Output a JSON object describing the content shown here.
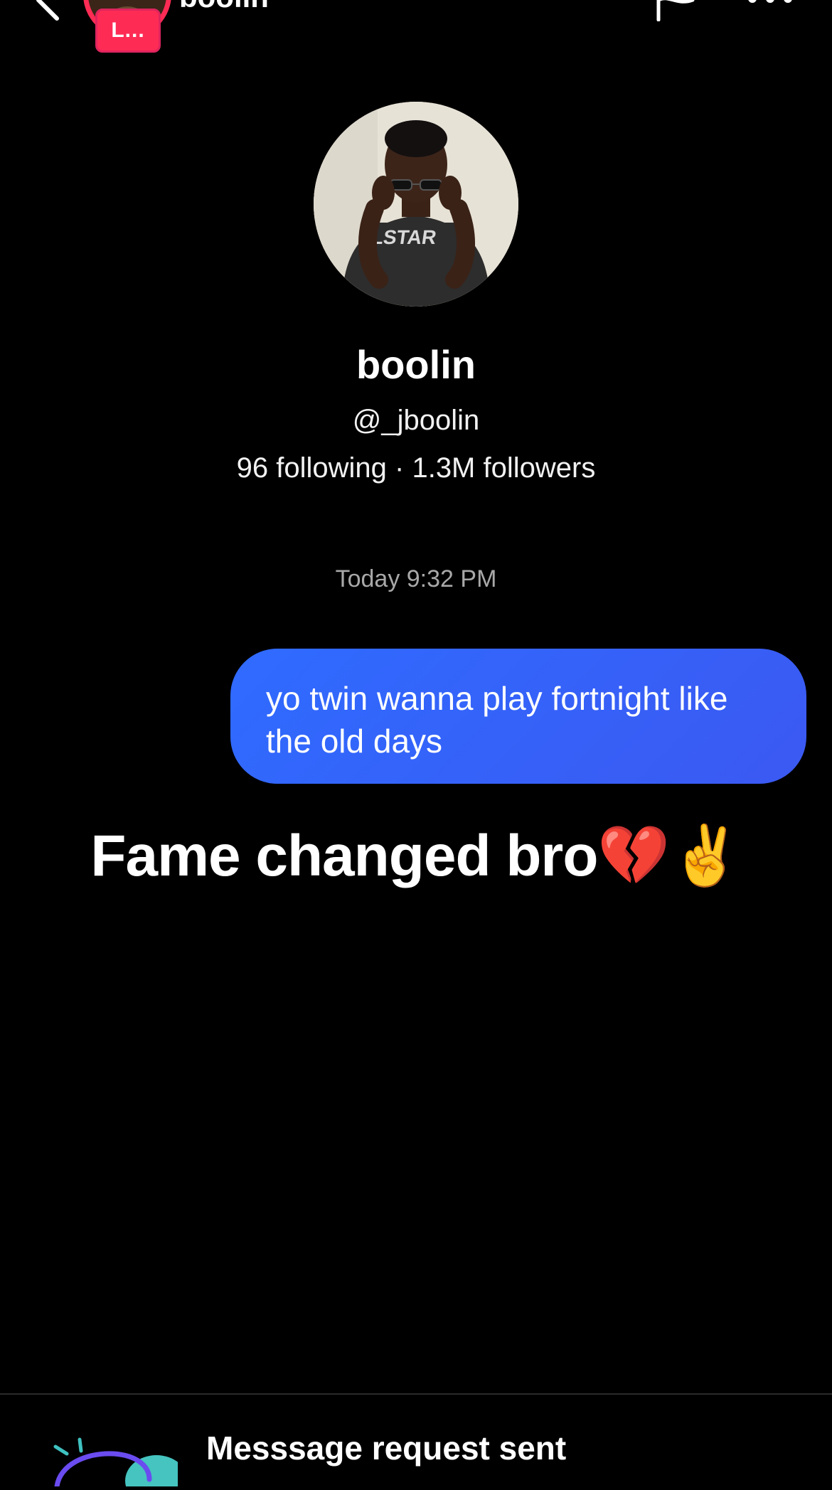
{
  "header": {
    "name": "boolin",
    "live_badge": "L...",
    "icons": {
      "back": "chevron-left-icon",
      "flag": "flag-icon",
      "more": "more-horizontal-icon"
    }
  },
  "profile": {
    "name": "boolin",
    "handle": "@_jboolin",
    "stats": "96 following · 1.3M followers"
  },
  "chat": {
    "timestamp": "Today 9:32 PM",
    "messages": [
      {
        "sender": "me",
        "text": "yo twin wanna play fortnight like the old days"
      }
    ]
  },
  "overlay": {
    "caption": "Fame changed bro💔✌️"
  },
  "footer": {
    "request_title": "Messsage request sent"
  },
  "colors": {
    "background": "#000000",
    "bubble_blue": "#2f6bff",
    "live_pink": "#fe2c55",
    "timestamp_gray": "#a8a8a8"
  }
}
